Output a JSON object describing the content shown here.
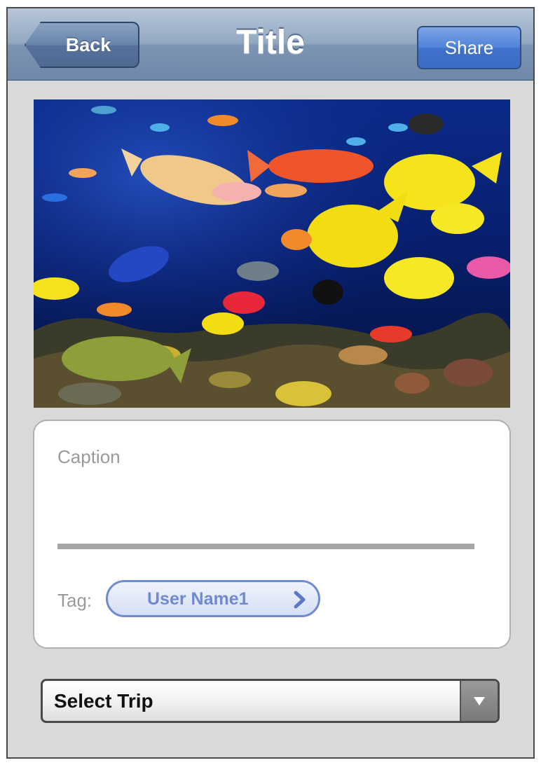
{
  "navbar": {
    "back_label": "Back",
    "title": "Title",
    "share_label": "Share"
  },
  "photo": {
    "subject": "aquarium-fish-photo"
  },
  "caption": {
    "placeholder": "Caption"
  },
  "tag": {
    "label": "Tag:",
    "user": "User Name1",
    "icon": "chevron-right-icon"
  },
  "trip_select": {
    "selected": "Select Trip",
    "icon": "triangle-down-icon"
  },
  "colors": {
    "navbar_top": "#b8c6d8",
    "navbar_bottom": "#6f87a8",
    "share_blue": "#4f82d8",
    "tag_blue": "#7189cd",
    "background": "#d9d9d9"
  }
}
